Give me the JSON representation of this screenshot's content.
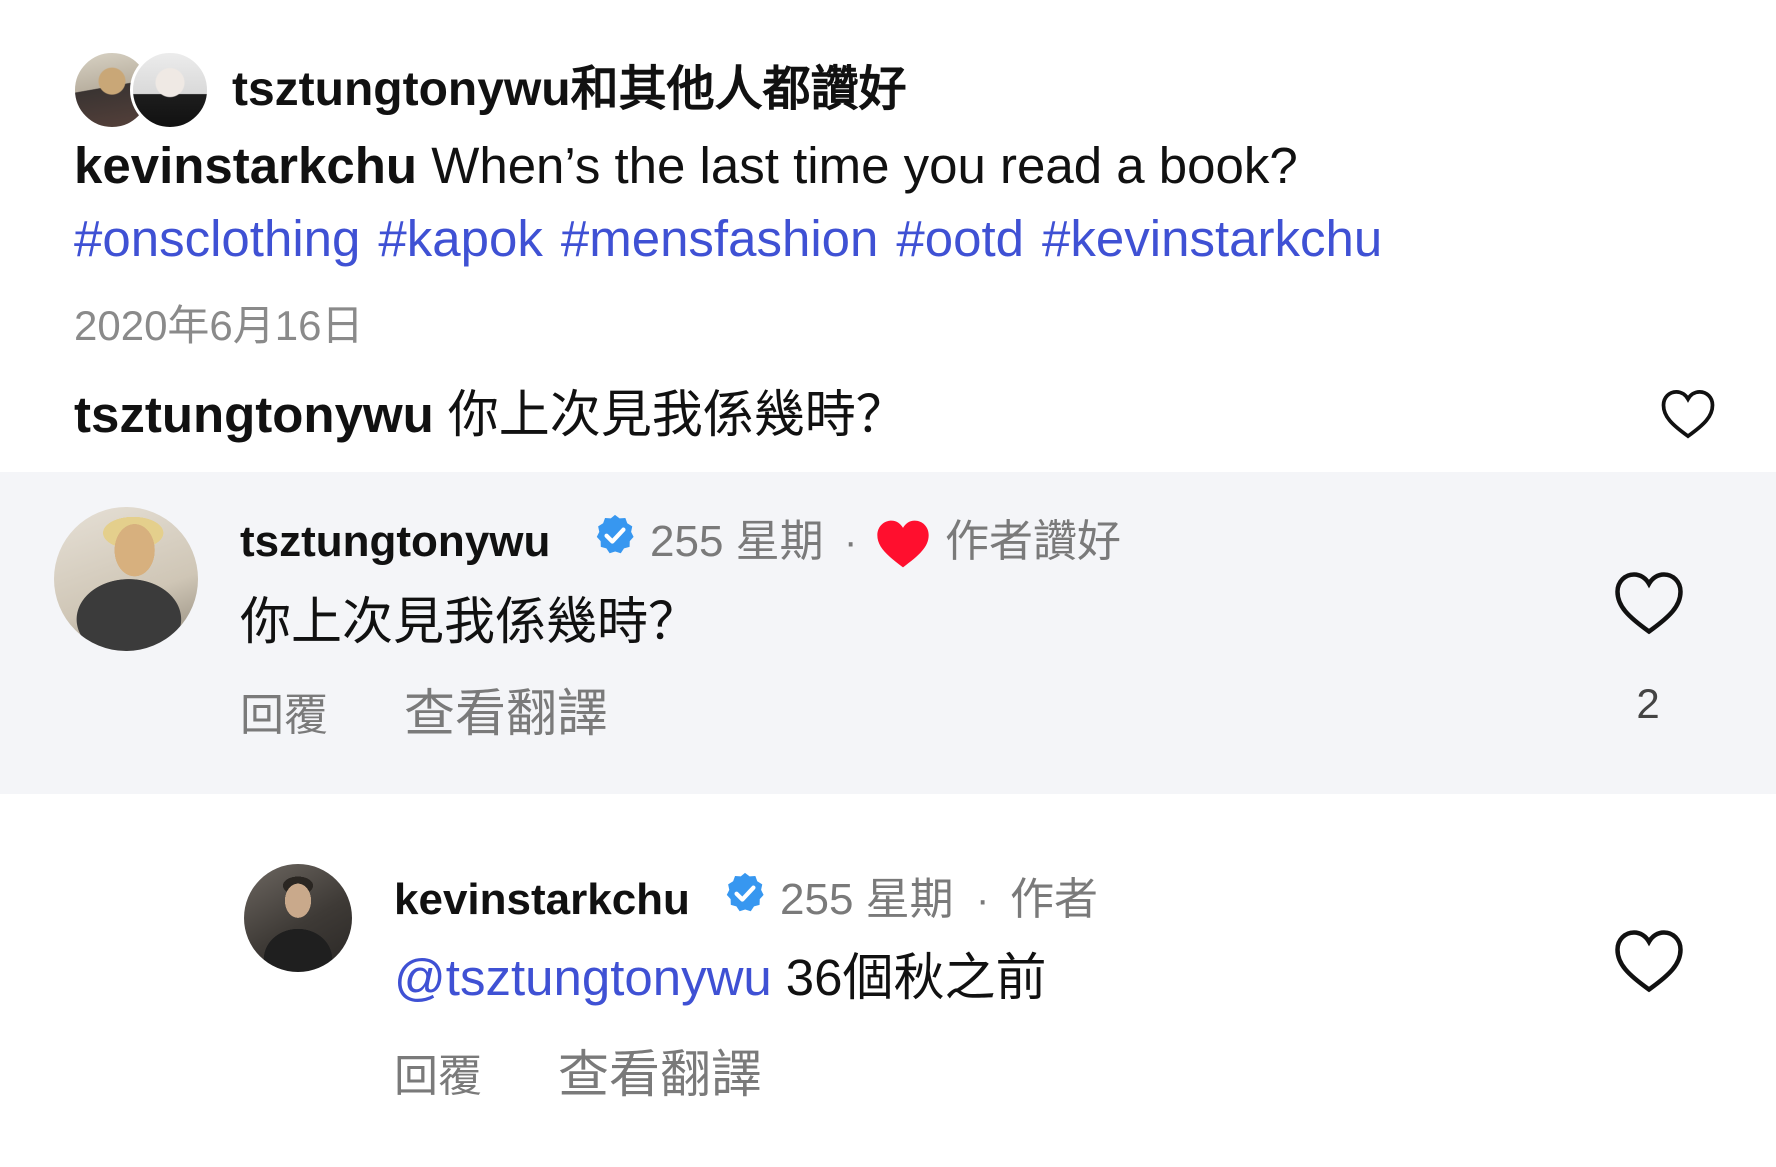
{
  "likes_header": {
    "text": "tsztungtonywu和其他人都讚好"
  },
  "post": {
    "author": "kevinstarkchu",
    "caption": "When’s the last time you read a book?",
    "hashtags": [
      "#onsclothing",
      "#kapok",
      "#mensfashion",
      "#ootd",
      "#kevinstarkchu"
    ],
    "date": "2020年6月16日"
  },
  "preview_comment": {
    "author": "tsztungtonywu",
    "text": "你上次見我係幾時？"
  },
  "comment": {
    "author": "tsztungtonywu",
    "verified": true,
    "time": "255 星期",
    "dot": "·",
    "author_liked": "作者讚好",
    "text": "你上次見我係幾時？",
    "reply_label": "回覆",
    "translate_label": "查看翻譯",
    "like_count": "2"
  },
  "reply": {
    "author": "kevinstarkchu",
    "verified": true,
    "time": "255 星期",
    "dot": "·",
    "badge": "作者",
    "mention": "@tsztungtonywu",
    "text": "36個秋之前",
    "reply_label": "回覆",
    "translate_label": "查看翻譯"
  },
  "colors": {
    "link_blue": "#3f51d4",
    "verified_blue": "#3797f0",
    "heart_red": "#ff0f2e",
    "highlight_bg": "#f4f5f8",
    "meta_gray": "#7a7a7a"
  },
  "icons": [
    "heart-outline-icon",
    "heart-filled-icon",
    "verified-badge-icon"
  ]
}
